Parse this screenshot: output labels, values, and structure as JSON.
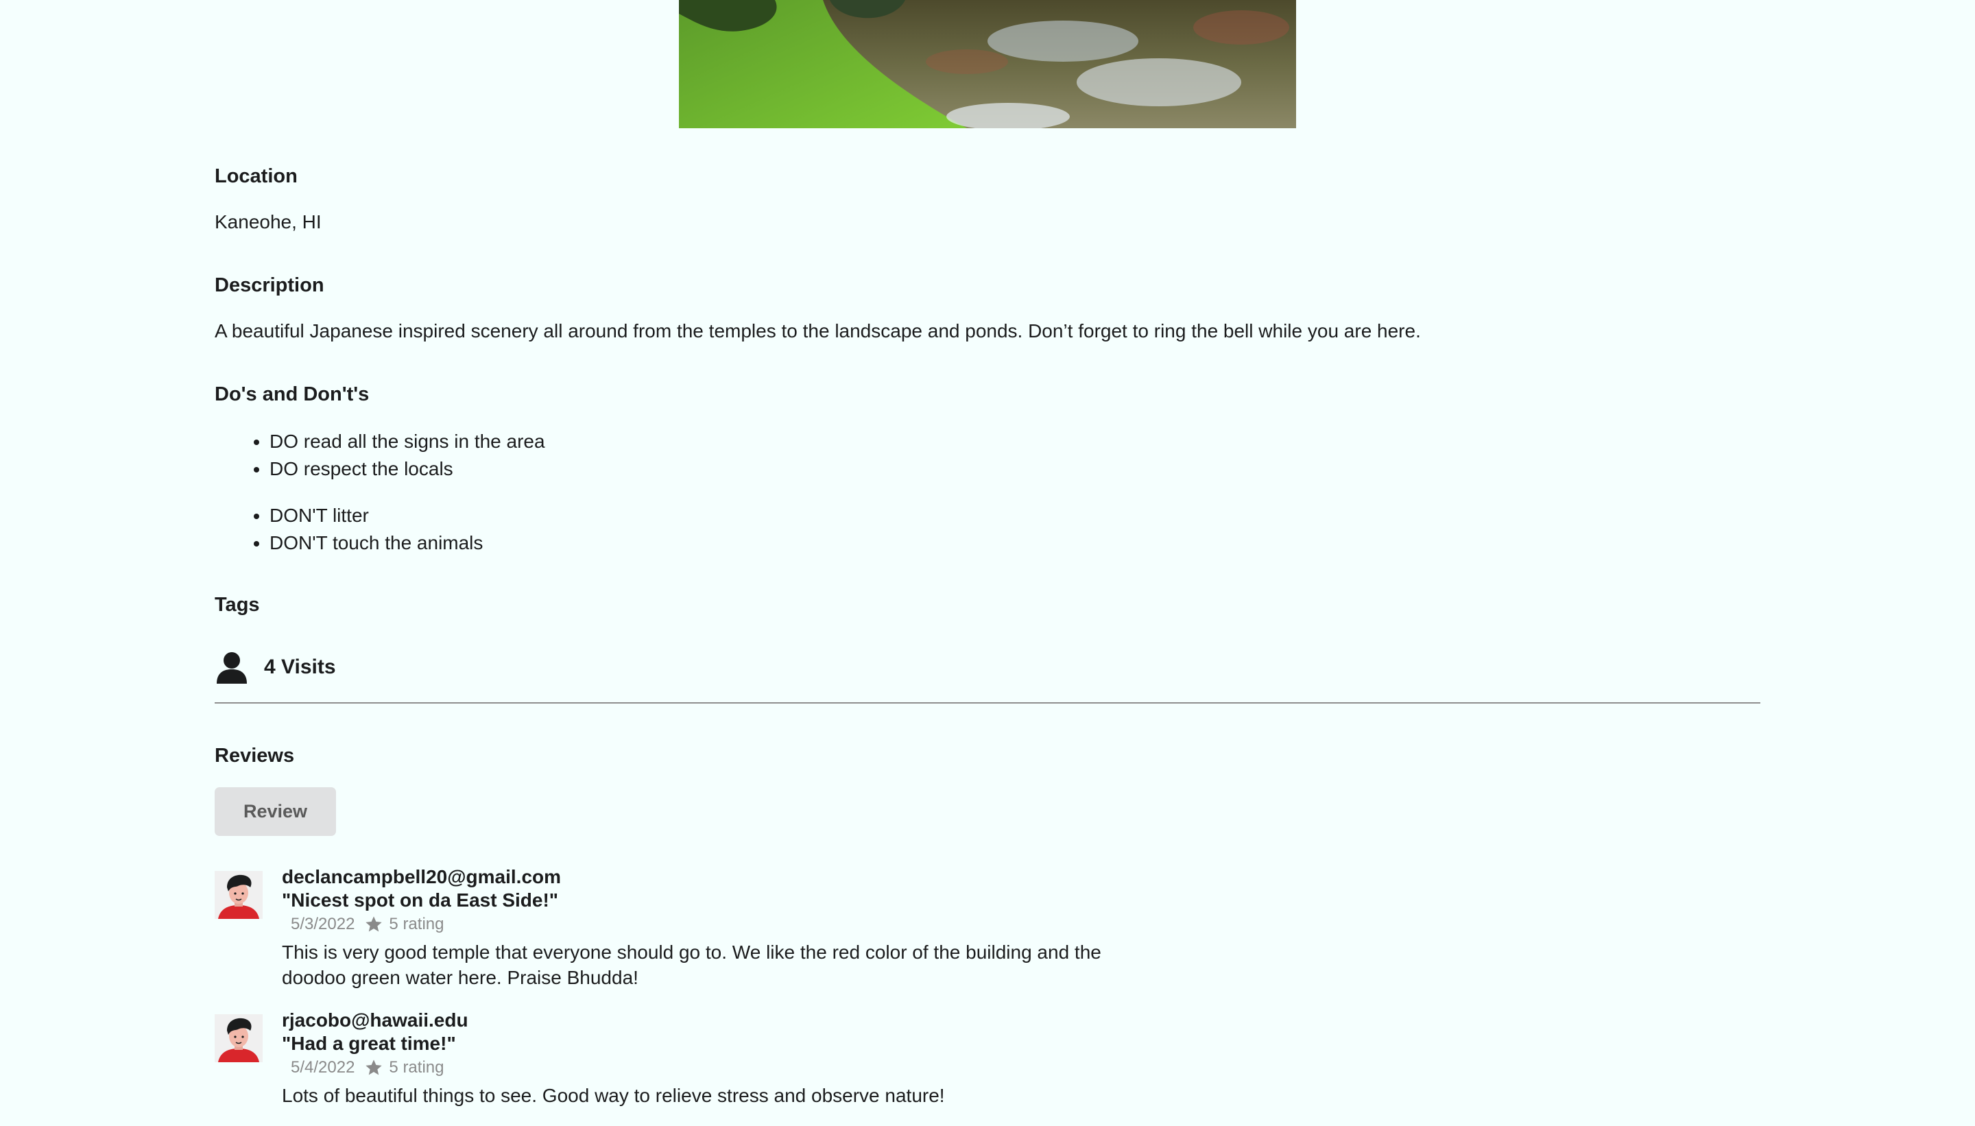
{
  "location": {
    "heading": "Location",
    "value": "Kaneohe, HI"
  },
  "description": {
    "heading": "Description",
    "value": "A beautiful Japanese inspired scenery all around from the temples to the landscape and ponds. Don’t forget to ring the bell while you are here."
  },
  "dos_donts": {
    "heading": "Do's and Don't's",
    "dos": [
      "DO read all the signs in the area",
      "DO respect the locals"
    ],
    "donts": [
      "DON'T litter",
      "DON'T touch the animals"
    ]
  },
  "tags": {
    "heading": "Tags"
  },
  "visits": {
    "icon": "user-icon",
    "label": "4 Visits"
  },
  "reviews": {
    "heading": "Reviews",
    "button_label": "Review",
    "items": [
      {
        "author": "declancampbell20@gmail.com",
        "summary": "\"Nicest spot on da East Side!\"",
        "date": "5/3/2022",
        "rating": "5 rating",
        "text": "This is very good temple that everyone should go to. We like the red color of the building and the doodoo green water here. Praise Bhudda!"
      },
      {
        "author": "rjacobo@hawaii.edu",
        "summary": "\"Had a great time!\"",
        "date": "5/4/2022",
        "rating": "5 rating",
        "text": "Lots of beautiful things to see. Good way to relieve stress and observe nature!"
      }
    ]
  },
  "colors": {
    "background": "#f5fffe",
    "divider": "#8e8e8e",
    "button_bg": "#e0e1e2",
    "meta_text": "#8a8a8a"
  }
}
